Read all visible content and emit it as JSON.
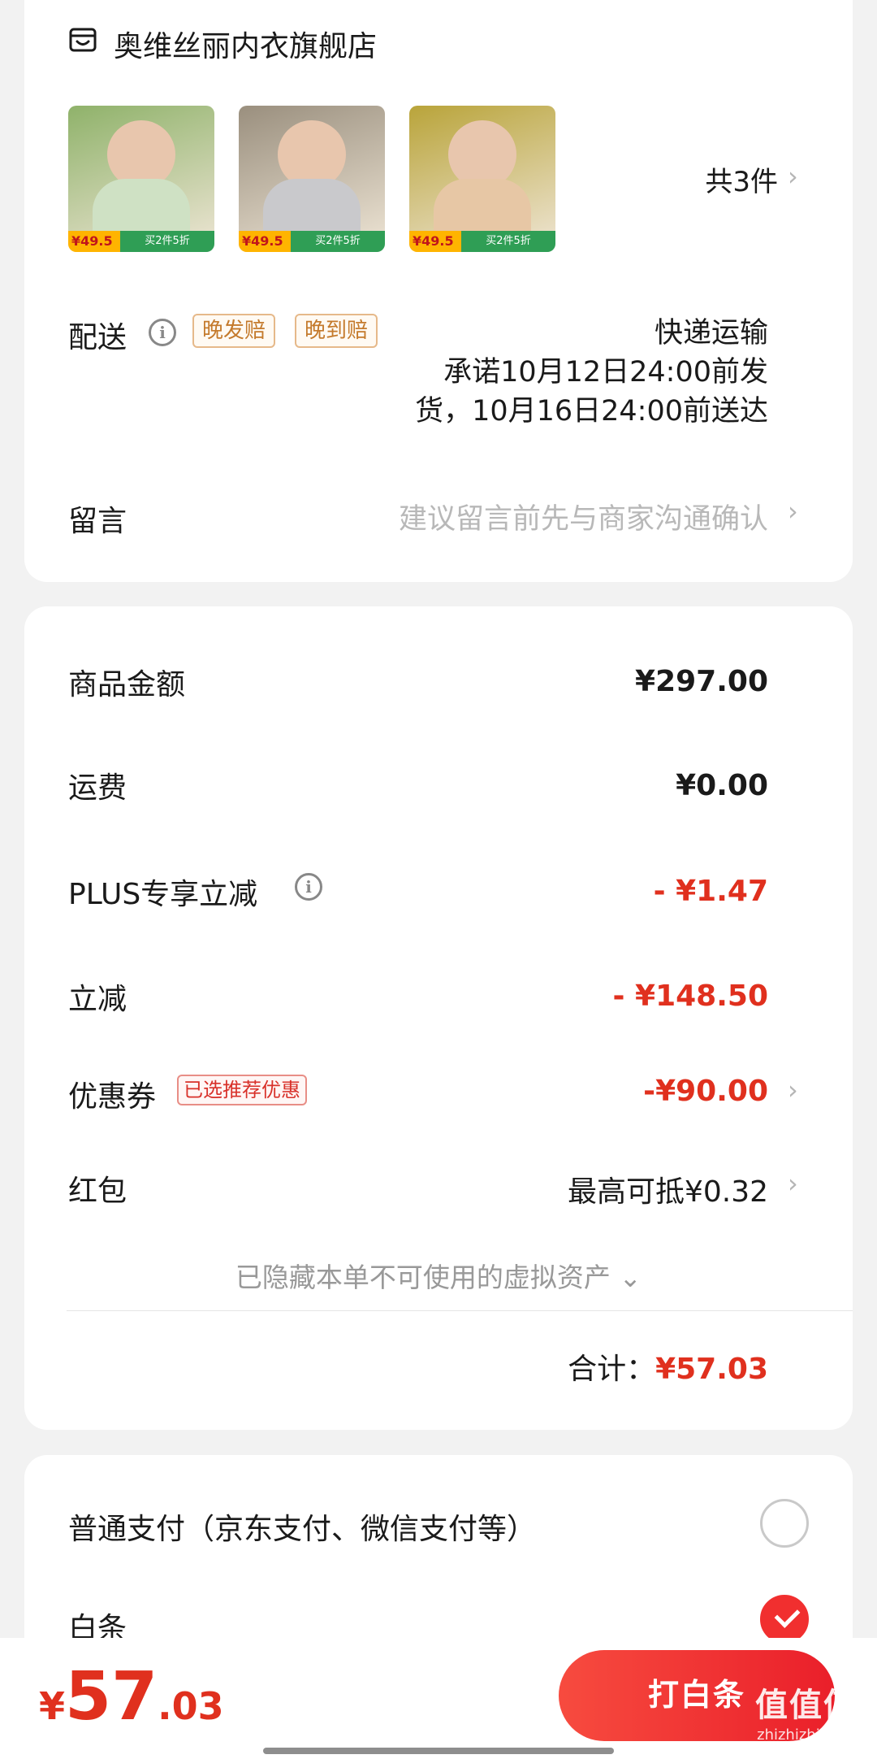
{
  "shop": {
    "name": "奥维丝丽内衣旗舰店",
    "icon": "shop-icon",
    "products": [
      {
        "price": "¥49.5",
        "promo": "买2件5折",
        "bg": "#8fb26a",
        "body": "#cfe1c4"
      },
      {
        "price": "¥49.5",
        "promo": "买2件5折",
        "bg": "#9a8f7e",
        "body": "#c9c9cc"
      },
      {
        "price": "¥49.5",
        "promo": "买2件5折",
        "bg": "#b9a43a",
        "body": "#e7c7a5"
      }
    ],
    "count_text": "共3件"
  },
  "delivery": {
    "label": "配送",
    "tags": [
      "晚发赔",
      "晚到赔"
    ],
    "method": "快递运输",
    "promise_line1": "承诺10月12日24:00前发",
    "promise_line2": "货，10月16日24:00前送达"
  },
  "remark": {
    "label": "留言",
    "placeholder": "建议留言前先与商家沟通确认"
  },
  "price_breakdown": {
    "goods": {
      "label": "商品金额",
      "value": "¥297.00"
    },
    "shipping": {
      "label": "运费",
      "value": "¥0.00"
    },
    "plus": {
      "label": "PLUS专享立减",
      "value": "- ¥1.47"
    },
    "instant": {
      "label": "立减",
      "value": "- ¥148.50"
    },
    "coupon": {
      "label": "优惠券",
      "tag": "已选推荐优惠",
      "value": "-¥90.00"
    },
    "red_packet": {
      "label": "红包",
      "value": "最高可抵¥0.32"
    },
    "hidden_note": "已隐藏本单不可使用的虚拟资产 ⌄",
    "total_label": "合计：",
    "total_value": "¥57.03"
  },
  "payment": {
    "normal": {
      "label": "普通支付（京东支付、微信支付等）",
      "selected": false
    },
    "baitiao": {
      "label": "白条",
      "selected": true
    }
  },
  "bottom": {
    "currency": "¥",
    "price_int": "57",
    "price_dec": ".03",
    "pay_label": "打白条",
    "watermark_main": "值值值",
    "watermark_sub": "zhizhizhi.com"
  },
  "colors": {
    "accent_red": "#e0301e",
    "pay_button": "#ea1f2a",
    "tag_orange": "#c47a2c"
  }
}
